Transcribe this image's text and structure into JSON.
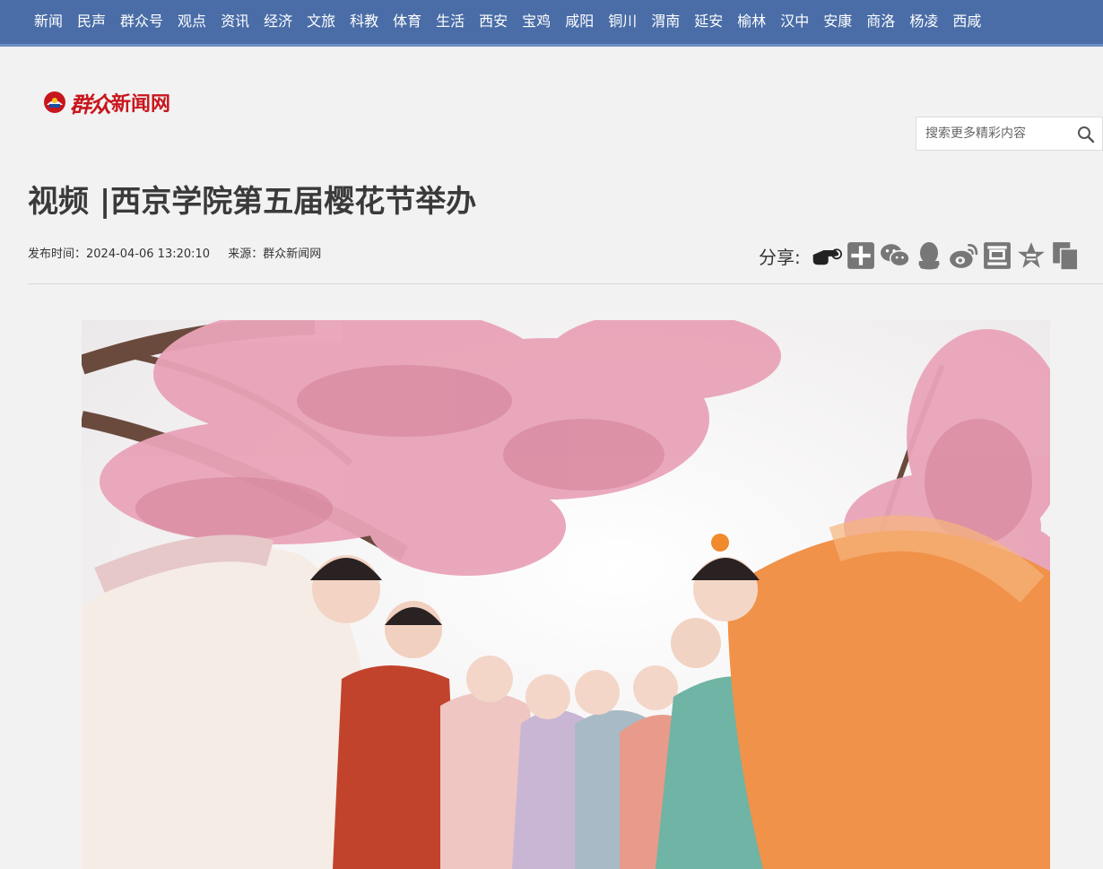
{
  "nav": {
    "items": [
      "新闻",
      "民声",
      "群众号",
      "观点",
      "资讯",
      "经济",
      "文旅",
      "科教",
      "体育",
      "生活",
      "西安",
      "宝鸡",
      "咸阳",
      "铜川",
      "渭南",
      "延安",
      "榆林",
      "汉中",
      "安康",
      "商洛",
      "杨凌",
      "西咸"
    ]
  },
  "logo": {
    "script": "群众",
    "text": "新闻网"
  },
  "search": {
    "placeholder": "搜索更多精彩内容",
    "icon": "search-icon"
  },
  "article": {
    "title": "视频 |西京学院第五届樱花节举办",
    "publish_time": "发布时间：2024-04-06 13:20:10",
    "source": "来源：群众新闻网"
  },
  "share": {
    "label": "分享:",
    "icons": [
      "hand-pointer-icon",
      "plus-icon",
      "wechat-icon",
      "qq-icon",
      "weibo-icon",
      "douban-icon",
      "qzone-icon",
      "copy-icon"
    ]
  },
  "colors": {
    "nav_bg": "#4a6da7",
    "brand_red": "#c8161d",
    "blossom_pink": "#e9a3b8"
  },
  "hero": {
    "alt": "Hanfu-dressed students under cherry blossoms"
  }
}
